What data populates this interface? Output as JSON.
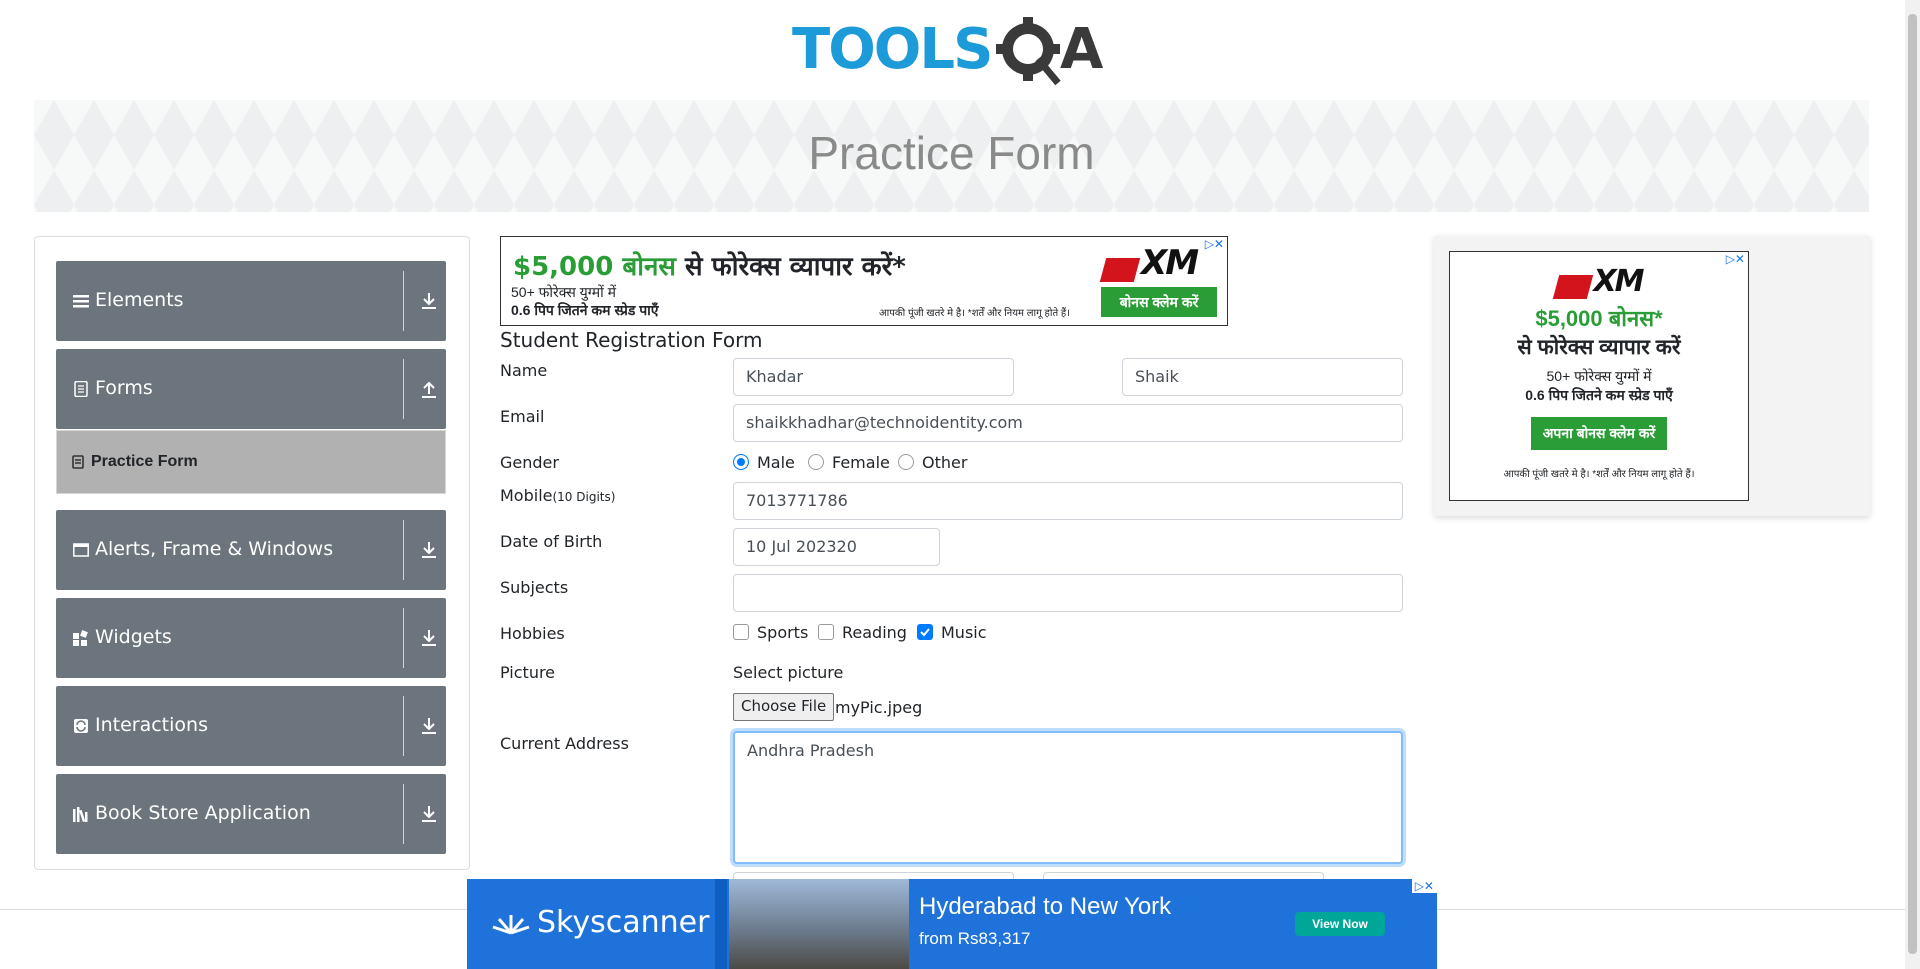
{
  "logo": {
    "text_left": "TOOLS",
    "text_right": "A"
  },
  "page": {
    "title": "Practice Form"
  },
  "sidebar": {
    "groups": [
      {
        "label": "Elements"
      },
      {
        "label": "Forms"
      },
      {
        "label": "Alerts, Frame & Windows"
      },
      {
        "label": "Widgets"
      },
      {
        "label": "Interactions"
      },
      {
        "label": "Book Store Application"
      }
    ],
    "active_item": "Practice Form"
  },
  "ad_top": {
    "headline_amount": "$5,000 बोनस",
    "headline_rest": " से फोरेक्स व्यापार करें*",
    "line1": "50+ फोरेक्स युग्मों में",
    "line2": "0.6 पिप जितने कम स्प्रेड पाएँ",
    "disclaimer": "आपकी पूंजी खतरे मे है। *शर्तें और नियम लागू होते हैं।",
    "cta": "बोनस क्लेम करें",
    "brand": "XM"
  },
  "ad_right": {
    "brand": "XM",
    "amount": "$5,000 बोनस*",
    "headline": "से फोरेक्स व्यापार करें",
    "line1": "50+ फोरेक्स युग्मों में",
    "line2": "0.6 पिप जितने कम स्प्रेड पाएँ",
    "cta": "अपना बोनस क्लेम करें",
    "disclaimer": "आपकी पूंजी खतरे मे है। *शर्तें और नियम लागू होते हैं।"
  },
  "form": {
    "title": "Student Registration Form",
    "name_label": "Name",
    "first_name": "Khadar",
    "last_name": "Shaik",
    "email_label": "Email",
    "email": "shaikkhadhar@technoidentity.com",
    "gender_label": "Gender",
    "genders": [
      "Male",
      "Female",
      "Other"
    ],
    "gender_selected": "Male",
    "mobile_label": "Mobile",
    "mobile_hint": "(10 Digits)",
    "mobile": "7013771786",
    "dob_label": "Date of Birth",
    "dob": "10 Jul 202320",
    "subjects_label": "Subjects",
    "subjects": "",
    "hobbies_label": "Hobbies",
    "hobbies": [
      {
        "label": "Sports",
        "checked": false
      },
      {
        "label": "Reading",
        "checked": false
      },
      {
        "label": "Music",
        "checked": true
      }
    ],
    "picture_label": "Picture",
    "select_picture": "Select picture",
    "choose_file": "Choose File",
    "file_name": "myPic.jpeg",
    "address_label": "Current Address",
    "address": "Andhra Pradesh"
  },
  "ad_bottom": {
    "brand": "Skyscanner",
    "route": "Hyderabad to New York",
    "price": "from Rs83,317",
    "cta": "View Now"
  },
  "colors": {
    "sidebar_group": "#6c757d",
    "active_item": "#b1b1b1",
    "primary": "#007bff",
    "logo_blue": "#1d9bd8",
    "ad_green": "#2b9d36",
    "skyscanner_blue": "#1e72d9"
  }
}
